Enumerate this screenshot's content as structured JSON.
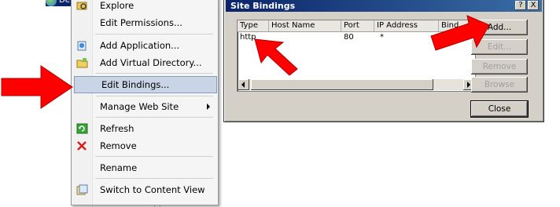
{
  "tree": {
    "node_text": "De"
  },
  "menu": {
    "items": [
      {
        "label": "Explore"
      },
      {
        "label": "Edit Permissions..."
      },
      {
        "label": "Add Application..."
      },
      {
        "label": "Add Virtual Directory..."
      },
      {
        "label": "Edit Bindings..."
      },
      {
        "label": "Manage Web Site"
      },
      {
        "label": "Refresh"
      },
      {
        "label": "Remove"
      },
      {
        "label": "Rename"
      },
      {
        "label": "Switch to Content View"
      }
    ]
  },
  "dialog": {
    "title": "Site Bindings",
    "title_buttons": [
      "?",
      "X"
    ],
    "columns": [
      "Type",
      "Host Name",
      "Port",
      "IP Address",
      "Bind"
    ],
    "rows": [
      {
        "type": "http",
        "host": "",
        "port": "80",
        "ip": "*",
        "bind": ""
      }
    ],
    "buttons": {
      "add": "Add...",
      "edit": "Edit...",
      "remove": "Remove",
      "browse": "Browse",
      "close": "Close"
    }
  },
  "colors": {
    "highlight": "#c9d4e6",
    "titlebar": "#0a246a",
    "annotation_arrow": "#ff0000"
  }
}
